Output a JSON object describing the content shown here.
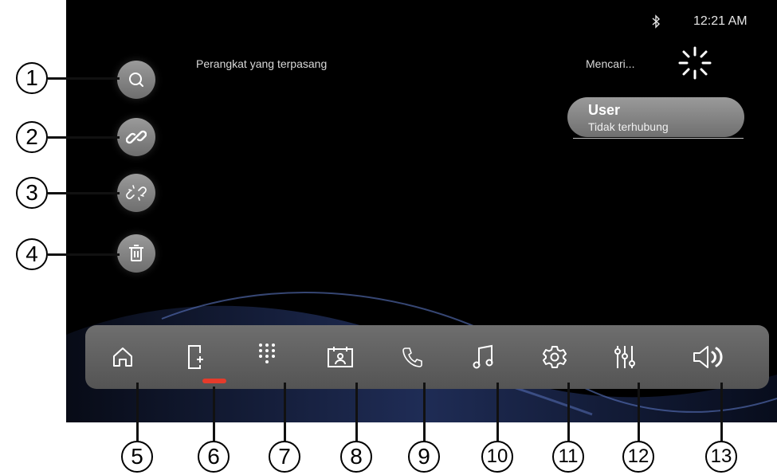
{
  "status": {
    "bluetooth_icon": "bluetooth-icon",
    "time": "12:21 AM"
  },
  "header": {
    "title": "Perangkat yang terpasang",
    "search_status": "Mencari..."
  },
  "devices": [
    {
      "name": "User",
      "state": "Tidak terhubung"
    }
  ],
  "side_buttons": [
    {
      "icon": "search-icon"
    },
    {
      "icon": "link-icon"
    },
    {
      "icon": "unlink-icon"
    },
    {
      "icon": "trash-icon"
    }
  ],
  "dock": [
    {
      "icon": "home-icon"
    },
    {
      "icon": "phone-add-icon",
      "active": true
    },
    {
      "icon": "dialpad-icon"
    },
    {
      "icon": "contacts-icon"
    },
    {
      "icon": "call-icon"
    },
    {
      "icon": "music-icon"
    },
    {
      "icon": "settings-icon"
    },
    {
      "icon": "equalizer-icon"
    },
    {
      "icon": "volume-icon"
    }
  ],
  "callouts": [
    "1",
    "2",
    "3",
    "4",
    "5",
    "6",
    "7",
    "8",
    "9",
    "10",
    "11",
    "12",
    "13"
  ],
  "colors": {
    "active_indicator": "#e53b2b",
    "button_gray": "#8a8a8a",
    "screen_bg": "#000000"
  }
}
